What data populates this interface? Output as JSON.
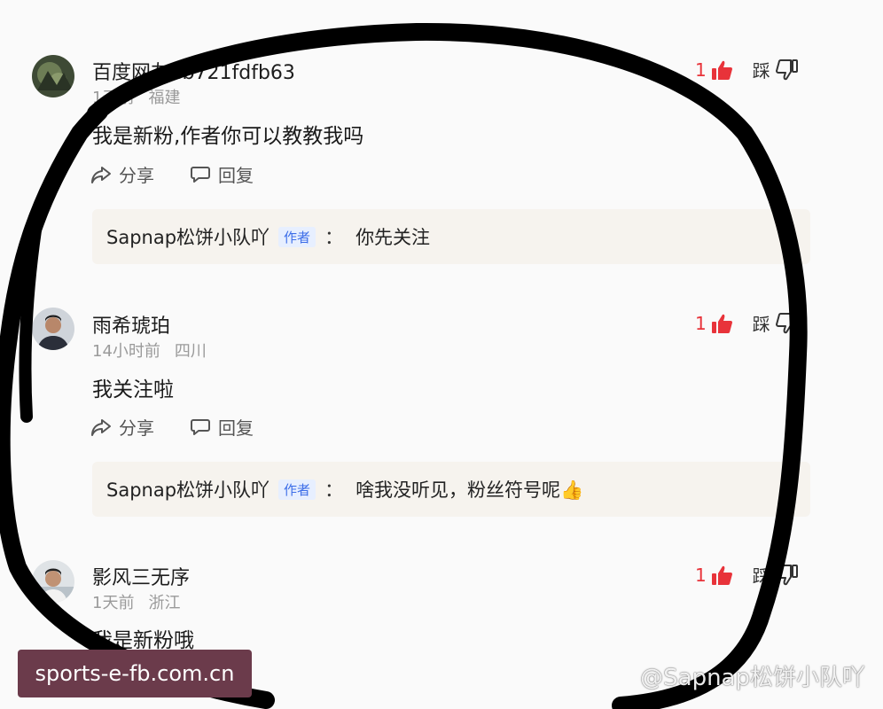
{
  "comments": [
    {
      "username": "百度网友eb721fdfb63",
      "time": "1天前",
      "location": "福建",
      "text": "我是新粉,作者你可以教教我吗",
      "likes": "1",
      "dislike_label": "踩",
      "share_label": "分享",
      "reply_label": "回复",
      "reply": {
        "author": "Sapnap松饼小队吖",
        "tag": "作者",
        "colon": "：",
        "text": "你先关注"
      }
    },
    {
      "username": "雨希琥珀",
      "time": "14小时前",
      "location": "四川",
      "text": "我关注啦",
      "likes": "1",
      "dislike_label": "踩",
      "share_label": "分享",
      "reply_label": "回复",
      "reply": {
        "author": "Sapnap松饼小队吖",
        "tag": "作者",
        "colon": "：",
        "text": "啥我没听见，粉丝符号呢👍"
      }
    },
    {
      "username": "影风三无序",
      "time": "1天前",
      "location": "浙江",
      "text": "我是新粉哦",
      "likes": "1",
      "dislike_label": "踩"
    }
  ],
  "overlay": {
    "site_badge": "sports-e-fb.com.cn",
    "watermark": "@Sapnap松饼小队吖"
  },
  "colors": {
    "like_red": "#e8333a",
    "author_tag_blue": "#3d6ee8",
    "reply_bg": "#f6f3ee",
    "badge_bg": "#6b3b4b"
  }
}
